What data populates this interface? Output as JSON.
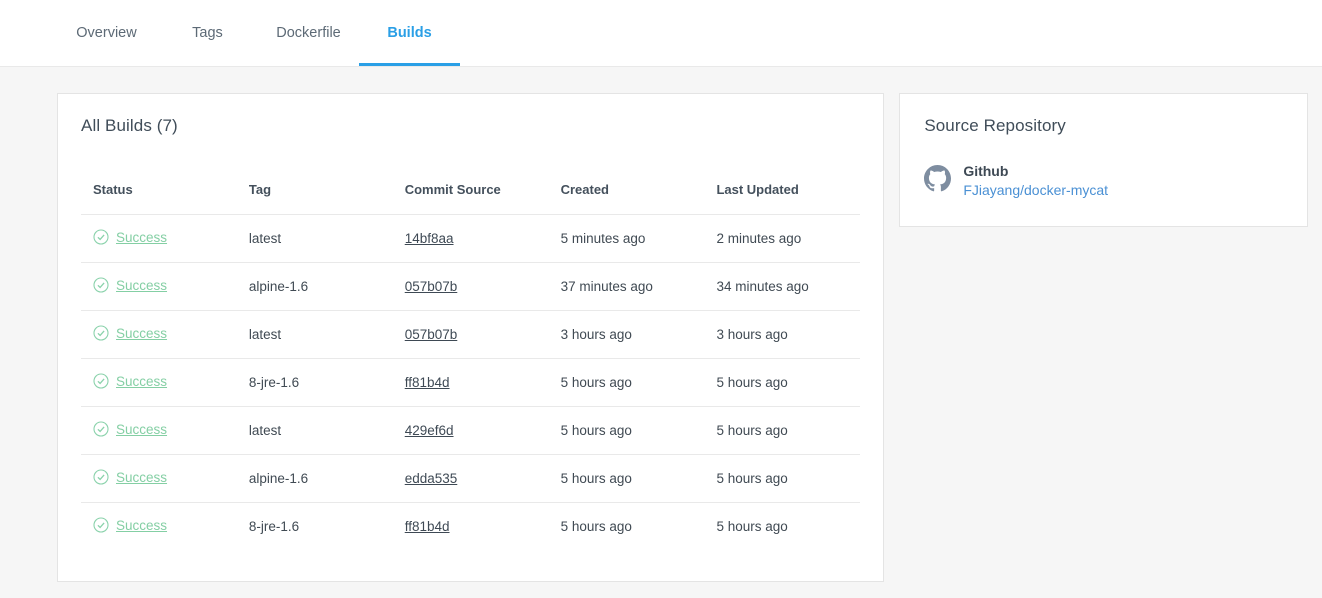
{
  "tabs": [
    {
      "label": "Overview",
      "active": false
    },
    {
      "label": "Tags",
      "active": false
    },
    {
      "label": "Dockerfile",
      "active": false
    },
    {
      "label": "Builds",
      "active": true
    }
  ],
  "builds_card": {
    "title": "All Builds (7)",
    "columns": [
      "Status",
      "Tag",
      "Commit Source",
      "Created",
      "Last Updated"
    ],
    "rows": [
      {
        "status": "Success",
        "tag": "latest",
        "commit": "14bf8aa",
        "created": "5 minutes ago",
        "updated": "2 minutes ago"
      },
      {
        "status": "Success",
        "tag": "alpine-1.6",
        "commit": "057b07b",
        "created": "37 minutes ago",
        "updated": "34 minutes ago"
      },
      {
        "status": "Success",
        "tag": "latest",
        "commit": "057b07b",
        "created": "3 hours ago",
        "updated": "3 hours ago"
      },
      {
        "status": "Success",
        "tag": "8-jre-1.6",
        "commit": "ff81b4d",
        "created": "5 hours ago",
        "updated": "5 hours ago"
      },
      {
        "status": "Success",
        "tag": "latest",
        "commit": "429ef6d",
        "created": "5 hours ago",
        "updated": "5 hours ago"
      },
      {
        "status": "Success",
        "tag": "alpine-1.6",
        "commit": "edda535",
        "created": "5 hours ago",
        "updated": "5 hours ago"
      },
      {
        "status": "Success",
        "tag": "8-jre-1.6",
        "commit": "ff81b4d",
        "created": "5 hours ago",
        "updated": "5 hours ago"
      }
    ]
  },
  "source_repository": {
    "title": "Source Repository",
    "provider": "Github",
    "repo": "FJiayang/docker-mycat",
    "icon": "github-icon"
  },
  "colors": {
    "accent_blue": "#2a9fe6",
    "success_green": "#84cfa4",
    "link_blue": "#4a90d4",
    "page_background": "#f6f6f6",
    "github_icon_gray": "#7e8da0"
  }
}
